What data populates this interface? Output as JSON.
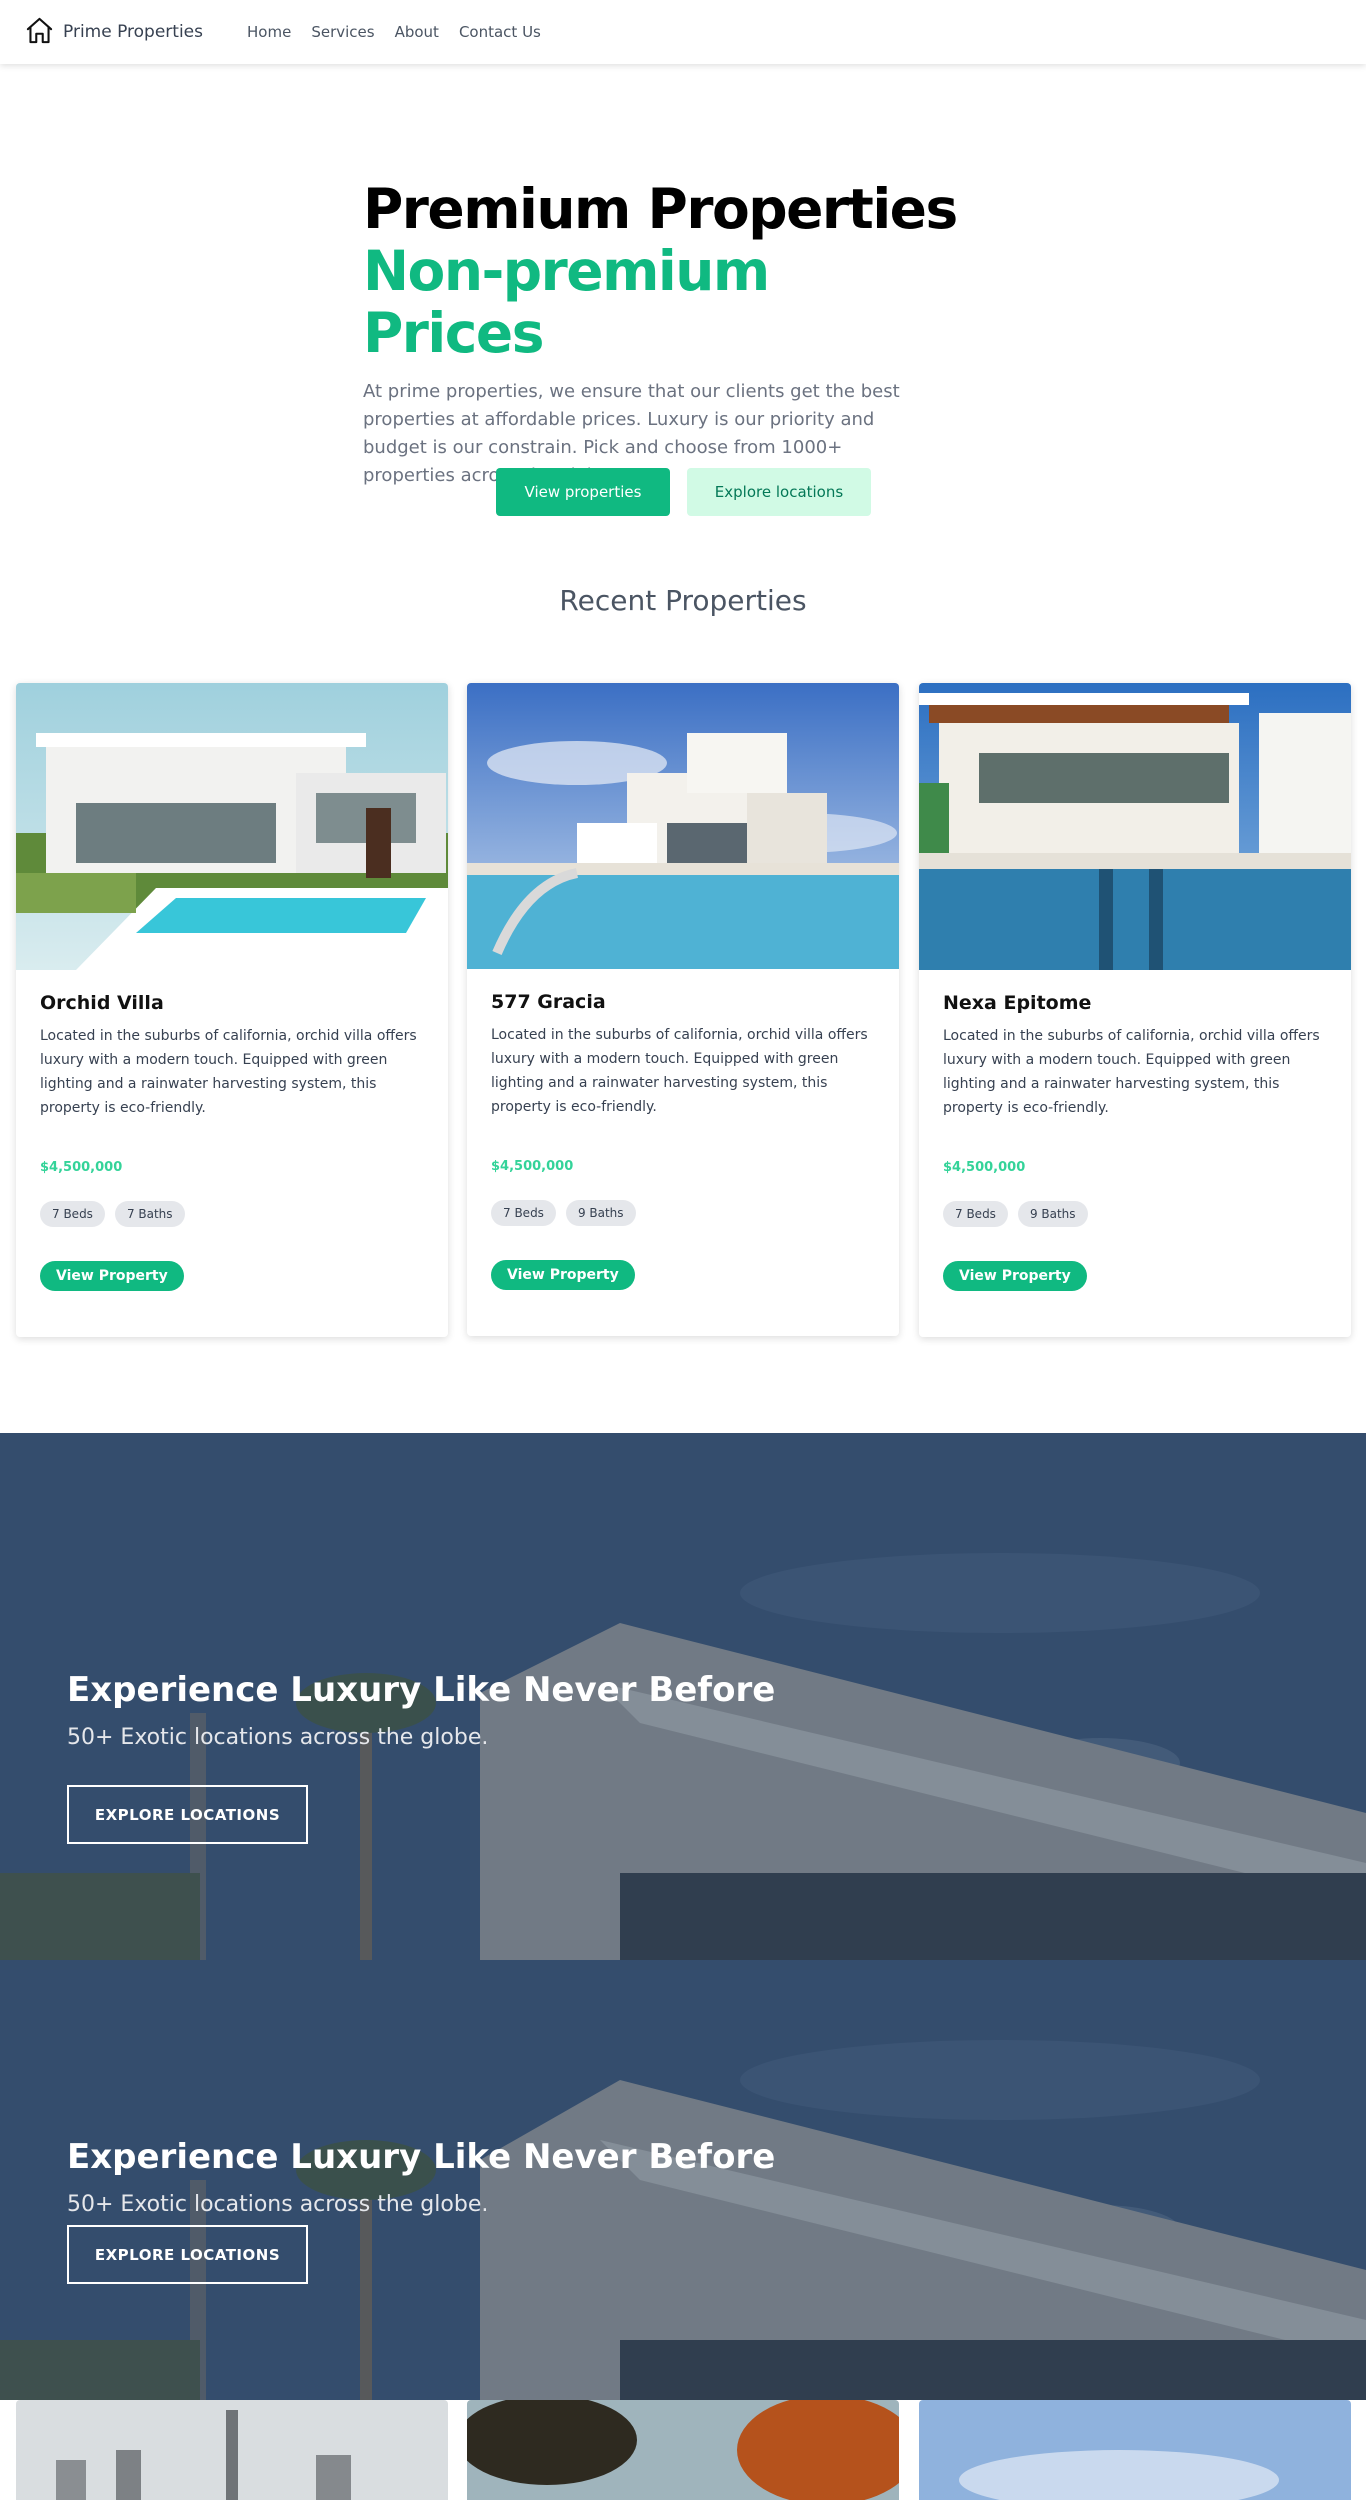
{
  "nav": {
    "brand": "Prime Properties",
    "brand_icon": "home-icon",
    "links": [
      "Home",
      "Services",
      "About",
      "Contact Us"
    ]
  },
  "hero": {
    "title_line1": "Premium Properties",
    "title_line2": "Non-premium Prices",
    "description": "At prime properties, we ensure that our clients get the best properties at affordable prices. Luxury is our priority and budget is our constrain. Pick and choose from 1000+ properties across the globe.",
    "primary_button": "View properties",
    "secondary_button": "Explore locations"
  },
  "recent": {
    "title": "Recent Properties",
    "cards": [
      {
        "title": "Orchid Villa",
        "description": "Located in the suburbs of california, orchid villa offers luxury with a modern touch. Equipped with green lighting and a rainwater harvesting system, this property is eco-friendly.",
        "price": "$4,500,000",
        "beds": "7 Beds",
        "baths": "7 Baths",
        "button": "View Property"
      },
      {
        "title": "577 Gracia",
        "description": "Located in the suburbs of california, orchid villa offers luxury with a modern touch. Equipped with green lighting and a rainwater harvesting system, this property is eco-friendly.",
        "price": "$4,500,000",
        "beds": "7 Beds",
        "baths": "9 Baths",
        "button": "View Property"
      },
      {
        "title": "Nexa Epitome",
        "description": "Located in the suburbs of california, orchid villa offers luxury with a modern touch. Equipped with green lighting and a rainwater harvesting system, this property is eco-friendly.",
        "price": "$4,500,000",
        "beds": "7 Beds",
        "baths": "9 Baths",
        "button": "View Property"
      }
    ]
  },
  "banners": [
    {
      "title": "Experience Luxury Like Never Before",
      "subtitle": "50+ Exotic locations across the globe.",
      "button": "EXPLORE LOCATIONS"
    },
    {
      "title": "Experience Luxury Like Never Before",
      "subtitle": "50+ Exotic locations across the globe.",
      "button": "EXPLORE LOCATIONS"
    }
  ],
  "colors": {
    "accent": "#10b981",
    "accent_light": "#d1fae5",
    "price": "#34d399",
    "banner_overlay": "#2c4463"
  }
}
